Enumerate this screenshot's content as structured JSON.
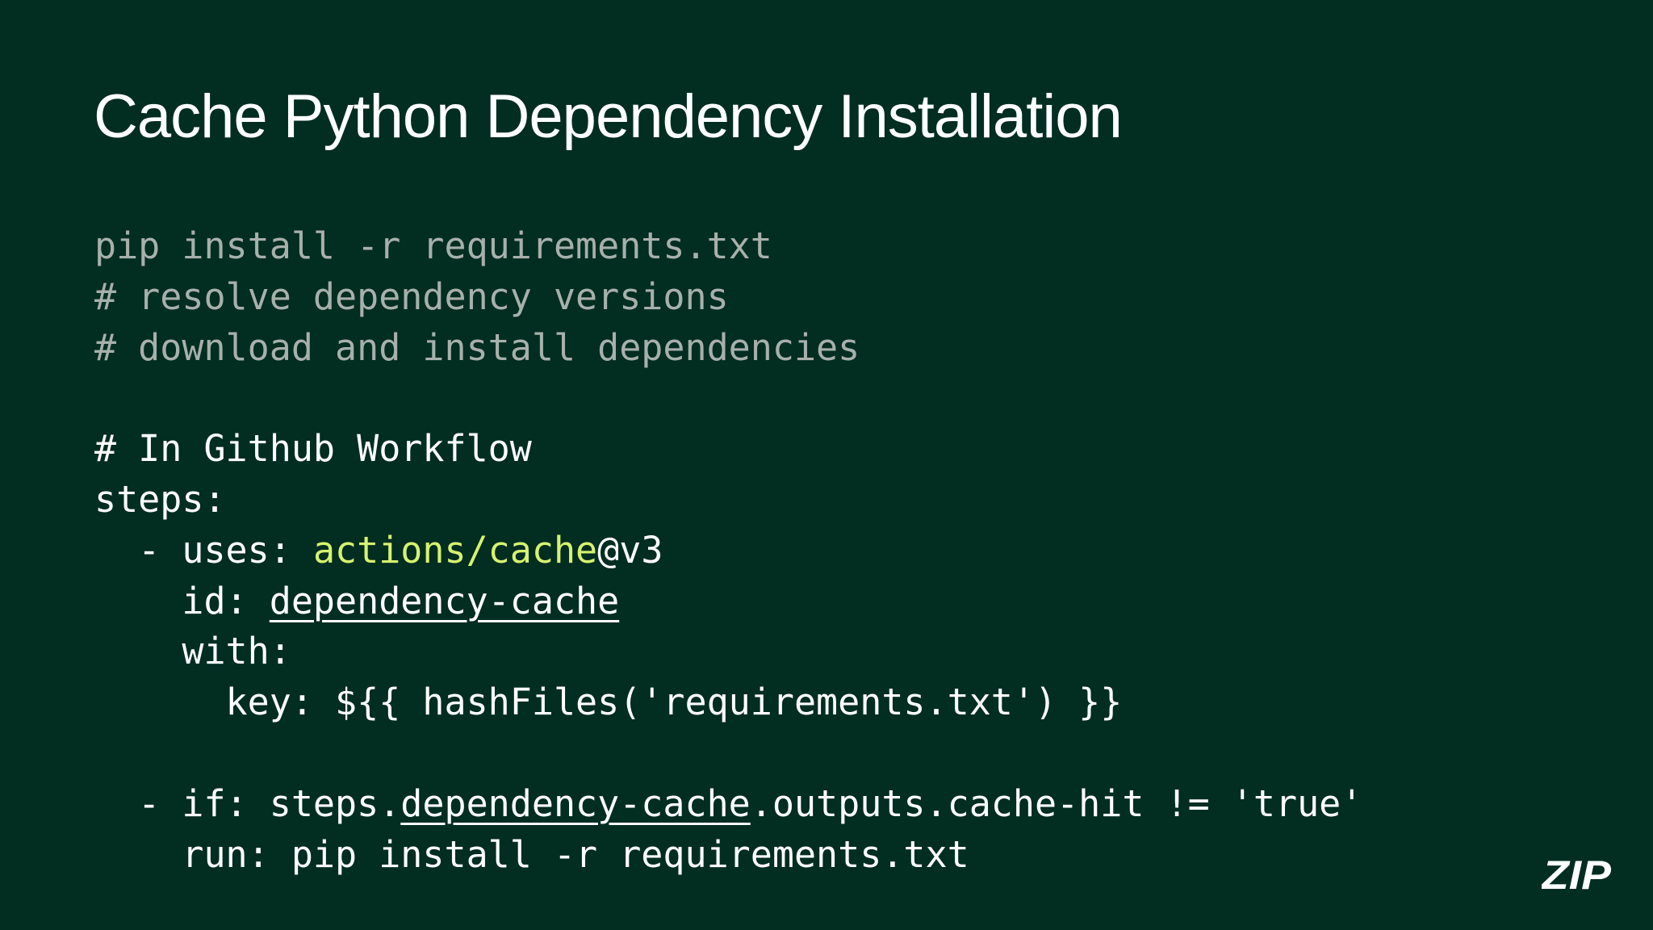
{
  "slide": {
    "title": "Cache Python Dependency Installation",
    "code": {
      "line1": "pip install -r requirements.txt",
      "line2": "# resolve dependency versions",
      "line3": "# download and install dependencies",
      "line5": "# In Github Workflow",
      "line6": "steps:",
      "line7_prefix": "  - uses: ",
      "line7_action": "actions/cache",
      "line7_version": "@v3",
      "line8_prefix": "    id: ",
      "line8_id": "dependency-cache",
      "line9": "    with:",
      "line10": "      key: ${{ hashFiles('requirements.txt') }}",
      "line12_prefix": "  - if: steps.",
      "line12_ref": "dependency-cache",
      "line12_suffix": ".outputs.cache-hit != 'true'",
      "line13": "    run: pip install -r requirements.txt"
    },
    "logo_text": "ZIP"
  },
  "colors": {
    "background": "#022d21",
    "title": "#ffffff",
    "code_text": "#ffffff",
    "comment_text": "#a7b0ab",
    "accent": "#d6f36f"
  }
}
